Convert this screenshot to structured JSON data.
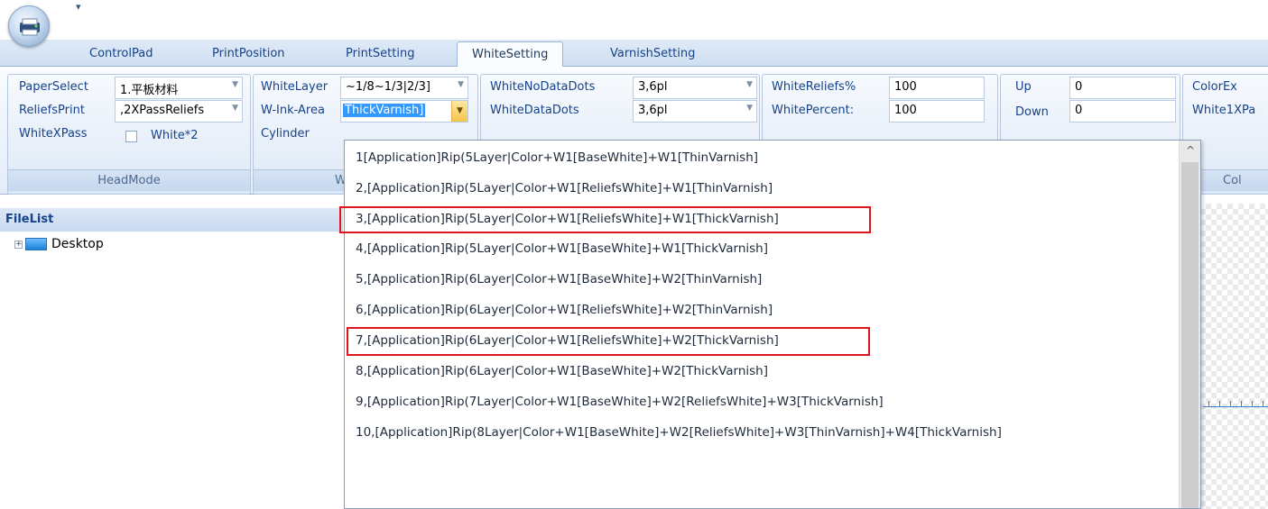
{
  "quick_access": {
    "arrow": "₹"
  },
  "tabs": [
    {
      "label": "ControlPad"
    },
    {
      "label": "PrintPosition"
    },
    {
      "label": "PrintSetting"
    },
    {
      "label": "WhiteSetting"
    },
    {
      "label": "VarnishSetting"
    }
  ],
  "active_tab": "WhiteSetting",
  "ribbon": {
    "headmode": {
      "paper_select_label": "PaperSelect",
      "paper_select_value": "1.平板材料",
      "reliefs_print_label": "ReliefsPrint",
      "reliefs_print_value": ",2XPassReliefs",
      "white_x_pass_label": "WhiteXPass",
      "white_x2_label": "White*2",
      "group_label": "HeadMode"
    },
    "white": {
      "white_layer_label": "WhiteLayer",
      "white_layer_value": "~1/8~1/3|2/3]",
      "w_ink_area_label": "W-Ink-Area",
      "w_ink_area_value": "ThickVarnish]",
      "cylinder_label": "Cylinder",
      "group_label_partial": "Wh"
    },
    "dots": {
      "white_nodata_label": "WhiteNoDataDots",
      "white_nodata_value": "3,6pl",
      "white_data_label": "WhiteDataDots",
      "white_data_value": "3,6pl"
    },
    "percents": {
      "reliefs_label": "WhiteReliefs%",
      "reliefs_value": "100",
      "percent_label": "WhitePercent:",
      "percent_value": "100"
    },
    "updown": {
      "up_label": "Up",
      "up_value": "0",
      "down_label": "Down",
      "down_value": "0"
    },
    "color": {
      "colorex_label": "ColorEx",
      "white1xpa_label": "White1XPa",
      "group_label_partial": "Col"
    }
  },
  "filelist": {
    "header": "FileList",
    "items": [
      {
        "label": "Desktop",
        "expander": "+"
      }
    ]
  },
  "dropdown": {
    "scroll_up": "^",
    "options": [
      "1[Application]Rip(5Layer|Color+W1[BaseWhite]+W1[ThinVarnish]",
      "2,[Application]Rip(5Layer|Color+W1[ReliefsWhite]+W1[ThinVarnish]",
      "3,[Application]Rip(5Layer|Color+W1[ReliefsWhite]+W1[ThickVarnish]",
      "4,[Application]Rip(5Layer|Color+W1[BaseWhite]+W1[ThickVarnish]",
      "5,[Application]Rip(6Layer|Color+W1[BaseWhite]+W2[ThinVarnish]",
      "6,[Application]Rip(6Layer|Color+W1[ReliefsWhite]+W2[ThinVarnish]",
      "7,[Application]Rip(6Layer|Color+W1[ReliefsWhite]+W2[ThickVarnish]",
      "8,[Application]Rip(6Layer|Color+W1[BaseWhite]+W2[ThickVarnish]",
      "9,[Application]Rip(7Layer|Color+W1[BaseWhite]+W2[ReliefsWhite]+W3[ThickVarnish]",
      "10,[Application]Rip(8Layer|Color+W1[BaseWhite]+W2[ReliefsWhite]+W3[ThinVarnish]+W4[ThickVarnish]"
    ],
    "highlighted_indices": [
      2,
      6
    ],
    "highlight_color": "#e0141d"
  },
  "icons": {
    "app_orb": "printer-icon",
    "dropdown_arrow": "chevron-down-icon",
    "tree_expander": "plus-icon",
    "desktop": "desktop-icon"
  }
}
